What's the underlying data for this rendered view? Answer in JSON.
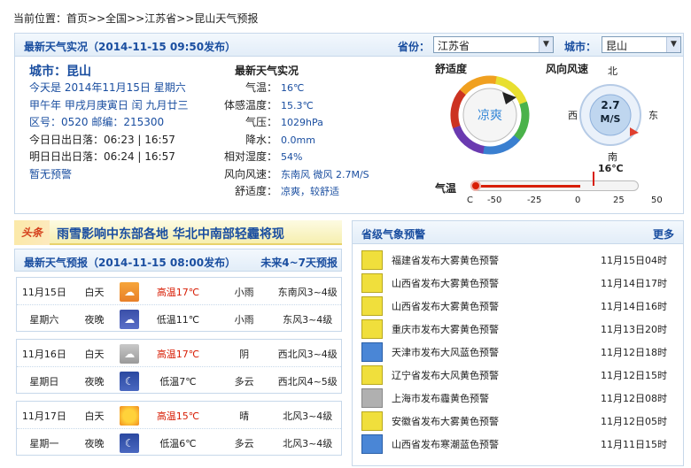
{
  "breadcrumb": {
    "prefix": "当前位置：",
    "items": [
      "首页",
      "全国",
      "江苏省",
      "昆山天气预报"
    ],
    "sep": ">>"
  },
  "top": {
    "title": "最新天气实况（2014-11-15 09:50发布）",
    "province_label": "省份：",
    "province_value": "江苏省",
    "city_label": "城市：",
    "city_value": "昆山",
    "city_name": "城市：昆山",
    "info": [
      "今天是 2014年11月15日 星期六",
      "甲午年 甲戌月庚寅日 闰 九月廿三",
      "区号：0520  邮编：215300",
      "今日日出日落：06:23 | 16:57",
      "明日日出日落：06:24 | 16:57",
      "暂无预警"
    ],
    "current_title": "最新天气实况",
    "current": [
      {
        "k": "气温：",
        "v": "16℃"
      },
      {
        "k": "体感温度：",
        "v": "15.3℃"
      },
      {
        "k": "气压：",
        "v": "1029hPa"
      },
      {
        "k": "降水：",
        "v": "0.0mm"
      },
      {
        "k": "相对湿度：",
        "v": "54%"
      },
      {
        "k": "风向风速：",
        "v": "东南风 微风 2.7M/S"
      },
      {
        "k": "舒适度：",
        "v": "凉爽，较舒适"
      }
    ],
    "comfort_title": "舒适度",
    "comfort_value": "凉爽",
    "wind_title": "风向风速",
    "wind_speed": "2.7",
    "wind_unit": "M/S",
    "compass": {
      "n": "北",
      "s": "南",
      "w": "西",
      "e": "东"
    },
    "temp_title": "气温",
    "temp_value": "16℃",
    "temp_reading": 16,
    "temp_ticks": [
      "C",
      "-50",
      "-25",
      "0",
      "25",
      "50"
    ]
  },
  "news": {
    "tag": "头条",
    "headline": "雨雪影响中东部各地 华北中南部轻霾将现"
  },
  "forecast": {
    "title": "最新天气预报（2014-11-15 08:00发布）",
    "right_link": "未来4~7天预报",
    "days": [
      {
        "date": "11月15日",
        "weekday": "星期六",
        "day": {
          "label": "白天",
          "icon": "light-rain-icon",
          "temp": "高温17℃",
          "weather": "小雨",
          "wind": "东南风3~4级"
        },
        "night": {
          "label": "夜晚",
          "icon": "light-rain-night-icon",
          "temp": "低温11℃",
          "weather": "小雨",
          "wind": "东风3~4级"
        }
      },
      {
        "date": "11月16日",
        "weekday": "星期日",
        "day": {
          "label": "白天",
          "icon": "overcast-icon",
          "temp": "高温17℃",
          "weather": "阴",
          "wind": "西北风3~4级"
        },
        "night": {
          "label": "夜晚",
          "icon": "cloudy-night-icon",
          "temp": "低温7℃",
          "weather": "多云",
          "wind": "西北风4~5级"
        }
      },
      {
        "date": "11月17日",
        "weekday": "星期一",
        "day": {
          "label": "白天",
          "icon": "sunny-icon",
          "temp": "高温15℃",
          "weather": "晴",
          "wind": "北风3~4级"
        },
        "night": {
          "label": "夜晚",
          "icon": "cloudy-night-icon",
          "temp": "低温6℃",
          "weather": "多云",
          "wind": "北风3~4级"
        }
      }
    ]
  },
  "warnings": {
    "title": "省级气象预警",
    "more": "更多",
    "items": [
      {
        "icon": "yellow-fog-warning-icon",
        "text": "福建省发布大雾黄色预警",
        "time": "11月15日04时"
      },
      {
        "icon": "yellow-fog-warning-icon",
        "text": "山西省发布大雾黄色预警",
        "time": "11月14日17时"
      },
      {
        "icon": "yellow-fog-warning-icon",
        "text": "山西省发布大雾黄色预警",
        "time": "11月14日16时"
      },
      {
        "icon": "yellow-fog-warning-icon",
        "text": "重庆市发布大雾黄色预警",
        "time": "11月13日20时"
      },
      {
        "icon": "blue-wind-warning-icon",
        "text": "天津市发布大风蓝色预警",
        "time": "11月12日18时"
      },
      {
        "icon": "yellow-wind-warning-icon",
        "text": "辽宁省发布大风黄色预警",
        "time": "11月12日15时"
      },
      {
        "icon": "yellow-haze-warning-icon",
        "text": "上海市发布霾黄色预警",
        "time": "11月12日08时"
      },
      {
        "icon": "yellow-fog-warning-icon",
        "text": "安徽省发布大雾黄色预警",
        "time": "11月12日05时"
      },
      {
        "icon": "blue-cold-wave-warning-icon",
        "text": "山西省发布寒潮蓝色预警",
        "time": "11月11日15时"
      }
    ]
  }
}
